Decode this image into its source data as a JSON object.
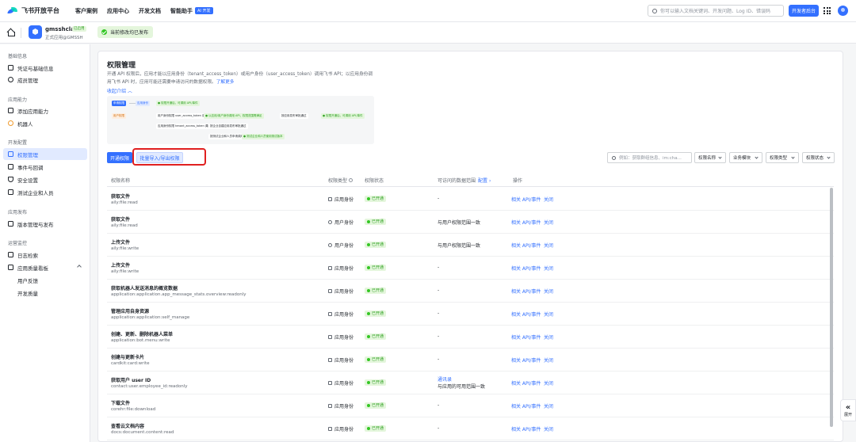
{
  "topnav": {
    "logo": "飞书开放平台",
    "links": [
      "客户案例",
      "应用中心",
      "开发文档",
      "智能助手"
    ],
    "ai_badge": "AI 开发",
    "search_placeholder": "你可以输入文档关键词、开发问题、Log ID、错误码",
    "console_button": "开发者后台"
  },
  "appbar": {
    "app_name": "gmsshclaw",
    "app_badge": "已启用",
    "app_sub": "正式应用@GMSSH",
    "published_text": "当前修改均已发布"
  },
  "sidebar": {
    "groups": [
      "基础信息",
      "应用能力",
      "开发配置",
      "应用发布",
      "运营监控"
    ],
    "items": [
      "凭证与基础信息",
      "成员管理",
      "添加应用能力",
      "机器人",
      "权限管理",
      "事件与回调",
      "安全设置",
      "测试企业和人员",
      "版本管理与发布",
      "日志检索",
      "应用质量看板",
      "用户反馈",
      "开发质量"
    ]
  },
  "page": {
    "title": "权限管理",
    "desc": "开通 API 权限后，应用才能以应用身份（tenant_access_token）或用户身份（user_access_token）调用飞书 API；以应用身份调用飞书 API 时，应用可能还需要申请访问的数据权限。",
    "learn_more": "了解更多",
    "collapse": "收起介绍"
  },
  "diagram": {
    "start": "申请权限",
    "app_identity": "应用身份",
    "app_tag": "应用权限",
    "app_result": "● 权限开通后，可调用 API/事件",
    "user_identity": "用户身份",
    "user_tag": "用户权限",
    "user_access": "用户身份权限 user_access_token 调用",
    "cond1": "● 以应用/用户身份调用 API，权限范围需满足",
    "cond2": "按应用发布审批通过",
    "user_result": "● 权限开通后，可调用 API/事件",
    "app_access": "应用身份权限 tenant_access_token 调用",
    "step_a": "按企业自建应用发布审批通过",
    "step_b": "按测试企业和人员直接调用",
    "step_c": "按测试企业和人员申请调用",
    "step_d": "● 测试企业和人员使用测试版本"
  },
  "toolbar": {
    "open_button": "开通权限",
    "import_button": "批量导入/导出权限",
    "search_placeholder": "例如：获取群组信息、im:cha...",
    "filters": [
      "权限名称",
      "业务模块",
      "权限类型",
      "权限状态"
    ]
  },
  "table": {
    "headers": {
      "name": "权限名称",
      "type": "权限类型",
      "status": "权限状态",
      "range": "可访问的数据范围",
      "range_link": "配置",
      "ops": "操作"
    },
    "rows": [
      {
        "name": "获取文件",
        "scope": "aily:file:read",
        "type": "应用身份",
        "status": "已开通",
        "range": "-",
        "range_link": "",
        "op1": "相关 API/事件",
        "op2": "关闭"
      },
      {
        "name": "获取文件",
        "scope": "aily:file:read",
        "type": "用户身份",
        "status": "已开通",
        "range": "与用户权限范围一致",
        "range_link": "",
        "op1": "相关 API/事件",
        "op2": "关闭"
      },
      {
        "name": "上传文件",
        "scope": "aily:file:write",
        "type": "用户身份",
        "status": "已开通",
        "range": "与用户权限范围一致",
        "range_link": "",
        "op1": "相关 API/事件",
        "op2": "关闭"
      },
      {
        "name": "上传文件",
        "scope": "aily:file:write",
        "type": "应用身份",
        "status": "已开通",
        "range": "-",
        "range_link": "",
        "op1": "相关 API/事件",
        "op2": "关闭"
      },
      {
        "name": "获取机器人发送消息的概览数据",
        "scope": "application:application.app_message_stats.overview:readonly",
        "type": "应用身份",
        "status": "已开通",
        "range": "-",
        "range_link": "",
        "op1": "相关 API/事件",
        "op2": "关闭"
      },
      {
        "name": "管理应用自身资源",
        "scope": "application:application:self_manage",
        "type": "应用身份",
        "status": "已开通",
        "range": "-",
        "range_link": "",
        "op1": "相关 API/事件",
        "op2": "关闭"
      },
      {
        "name": "创建、更新、删除机器人菜单",
        "scope": "application:bot.menu:write",
        "type": "应用身份",
        "status": "已开通",
        "range": "-",
        "range_link": "",
        "op1": "相关 API/事件",
        "op2": "关闭"
      },
      {
        "name": "创建与更新卡片",
        "scope": "cardkit:card:write",
        "type": "应用身份",
        "status": "已开通",
        "range": "-",
        "range_link": "",
        "op1": "相关 API/事件",
        "op2": "关闭"
      },
      {
        "name": "获取用户 user ID",
        "scope": "contact:user.employee_id:readonly",
        "type": "应用身份",
        "status": "已开通",
        "range": "与应用的可用范围一致",
        "range_link": "通讯录",
        "op1": "相关 API/事件",
        "op2": "关闭"
      },
      {
        "name": "下载文件",
        "scope": "corehr:file:download",
        "type": "应用身份",
        "status": "已开通",
        "range": "-",
        "range_link": "",
        "op1": "相关 API/事件",
        "op2": "关闭"
      },
      {
        "name": "查看云文档内容",
        "scope": "docs:document.content:read",
        "type": "应用身份",
        "status": "已开通",
        "range": "-",
        "range_link": "",
        "op1": "相关 API/事件",
        "op2": "关闭"
      }
    ]
  },
  "expand_label": "展开"
}
